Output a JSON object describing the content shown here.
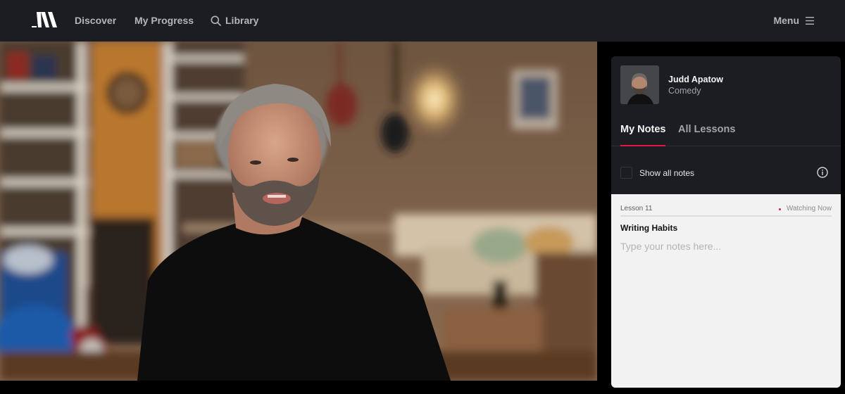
{
  "nav": {
    "logo": "masterclass-logo",
    "links": [
      "Discover",
      "My Progress",
      "Library"
    ],
    "menu_label": "Menu",
    "colors": {
      "bar": "#1b1d22",
      "link": "#b3b5b9"
    }
  },
  "video": {
    "description": "Instructor speaking in a living room with guitars, bookshelves and a lamp"
  },
  "panel": {
    "instructor": {
      "name": "Judd Apatow",
      "category": "Comedy"
    },
    "tabs": [
      {
        "label": "My Notes",
        "active": true
      },
      {
        "label": "All Lessons",
        "active": false
      }
    ],
    "show_all_notes": {
      "label": "Show all notes",
      "checked": false
    },
    "note": {
      "lesson": "Lesson 11",
      "status": "Watching Now",
      "title": "Writing Habits",
      "placeholder": "Type your notes here...",
      "value": ""
    },
    "accent_color": "#e3164a"
  }
}
